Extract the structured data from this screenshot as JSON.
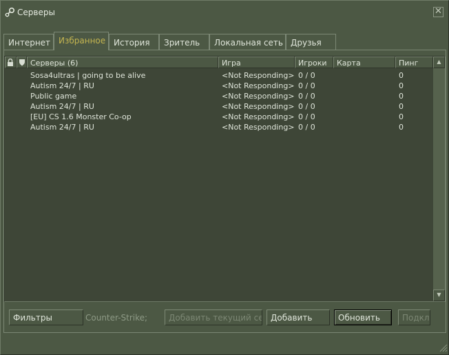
{
  "window": {
    "title": "Серверы",
    "close_label": "✕"
  },
  "tabs": [
    {
      "label": "Интернет",
      "active": false
    },
    {
      "label": "Избранное",
      "active": true
    },
    {
      "label": "История",
      "active": false
    },
    {
      "label": "Зритель",
      "active": false
    },
    {
      "label": "Локальная сеть",
      "active": false
    },
    {
      "label": "Друзья",
      "active": false
    }
  ],
  "columns": {
    "lock_icon": "lock-icon",
    "shield_icon": "shield-icon",
    "servers": "Серверы (6)",
    "game": "Игра",
    "players": "Игроки",
    "map": "Карта",
    "ping": "Пинг"
  },
  "servers": [
    {
      "name": "Sosa4ultras | going to be alive",
      "game": "<Not Responding>",
      "players": "0 / 0",
      "map": "",
      "ping": "0"
    },
    {
      "name": "Autism 24/7 | RU",
      "game": "<Not Responding>",
      "players": "0 / 0",
      "map": "",
      "ping": "0"
    },
    {
      "name": "Public game",
      "game": "<Not Responding>",
      "players": "0 / 0",
      "map": "",
      "ping": "0"
    },
    {
      "name": "Autism 24/7 | RU",
      "game": "<Not Responding>",
      "players": "0 / 0",
      "map": "",
      "ping": "0"
    },
    {
      "name": "[EU] CS 1.6 Monster Co-op",
      "game": "<Not Responding>",
      "players": "0 / 0",
      "map": "",
      "ping": "0"
    },
    {
      "name": "Autism 24/7 | RU",
      "game": "<Not Responding>",
      "players": "0 / 0",
      "map": "",
      "ping": "0"
    }
  ],
  "footer": {
    "filters_label": "Фильтры",
    "filter_game": "Counter-Strike;",
    "add_current_label": "Добавить текущий се...",
    "add_label": "Добавить",
    "refresh_label": "Обновить",
    "connect_label": "Подкл."
  },
  "colors": {
    "active_tab": "#c4b550",
    "background": "#4c5844",
    "list_bg": "#3e4637"
  }
}
